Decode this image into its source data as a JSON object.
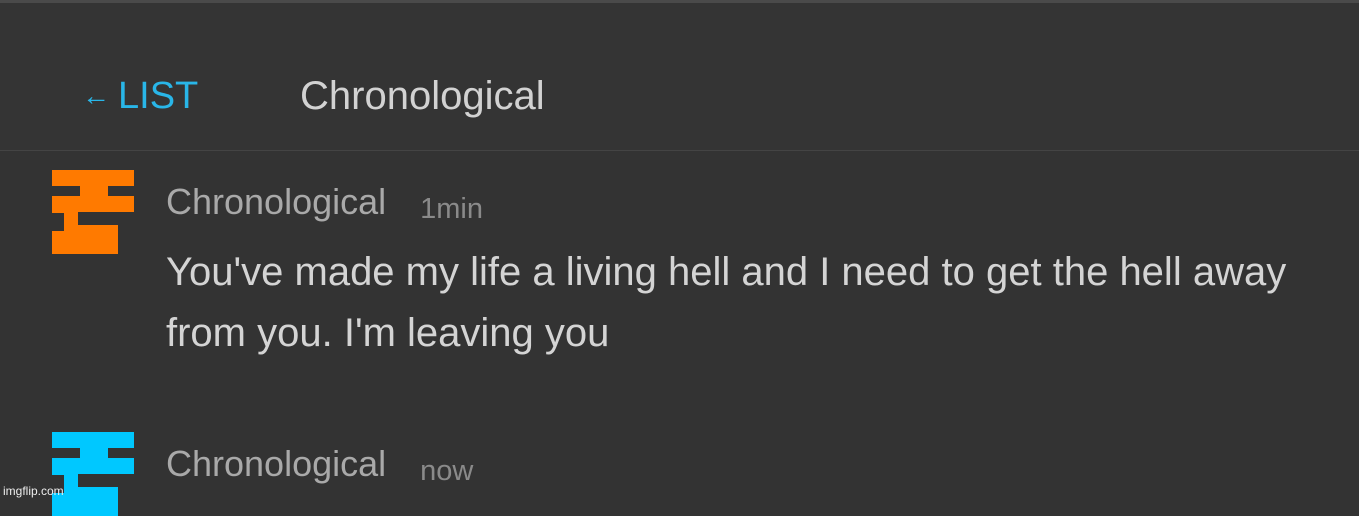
{
  "header": {
    "back_arrow": "←",
    "back_label": "LIST",
    "title": "Chronological"
  },
  "messages": [
    {
      "author": "Chronological",
      "time": "1min",
      "text": "You've made my life a living hell and I need to get the hell away from you. I'm leaving you",
      "avatar_color": "#ff7a00"
    },
    {
      "author": "Chronological",
      "time": "now",
      "text": "",
      "avatar_color": "#00c8ff"
    }
  ],
  "watermark": "imgflip.com"
}
